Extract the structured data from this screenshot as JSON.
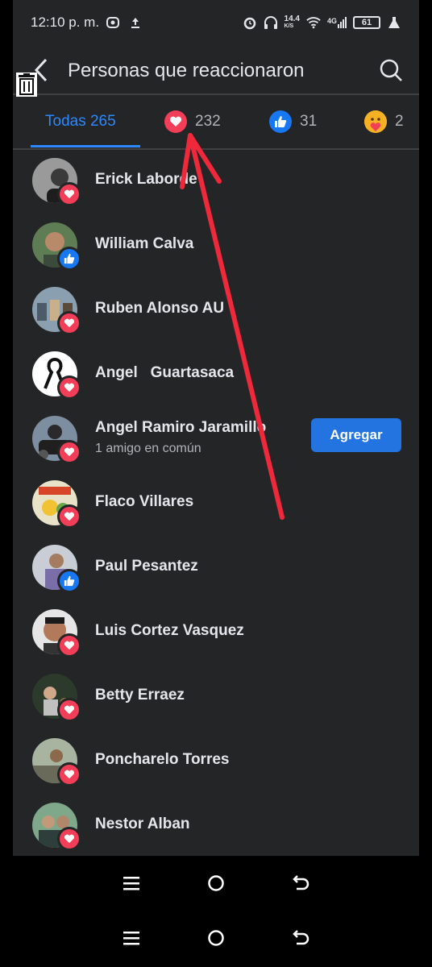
{
  "status_bar": {
    "time": "12:10 p. m.",
    "network_speed": "14.4",
    "network_unit": "K/S",
    "signal_label": "4G",
    "battery": "61"
  },
  "header": {
    "title": "Personas que reaccionaron"
  },
  "tabs": [
    {
      "label": "Todas 265",
      "icon": "none"
    },
    {
      "count": "232",
      "icon": "love"
    },
    {
      "count": "31",
      "icon": "like"
    },
    {
      "count": "2",
      "icon": "haha"
    }
  ],
  "people": [
    {
      "name": "Erick Laborde",
      "reaction": "love"
    },
    {
      "name": "William Calva",
      "reaction": "like"
    },
    {
      "name": "Ruben Alonso AU",
      "reaction": "love"
    },
    {
      "name": "Angel   Guartasaca",
      "reaction": "love"
    },
    {
      "name": "Angel Ramiro Jaramillo",
      "subtitle": "1 amigo en común",
      "reaction": "love",
      "action": "Agregar"
    },
    {
      "name": "Flaco Villares",
      "reaction": "love"
    },
    {
      "name": "Paul Pesantez",
      "reaction": "like"
    },
    {
      "name": "Luis Cortez Vasquez",
      "reaction": "love"
    },
    {
      "name": "Betty Erraez",
      "reaction": "love"
    },
    {
      "name": "Poncharelo Torres",
      "reaction": "love"
    },
    {
      "name": "Nestor Alban",
      "reaction": "love"
    }
  ],
  "colors": {
    "accent": "#2d88ff",
    "background": "#242526",
    "love": "#f33e58",
    "like": "#1877f2",
    "annotation_arrow": "#f0283c"
  }
}
